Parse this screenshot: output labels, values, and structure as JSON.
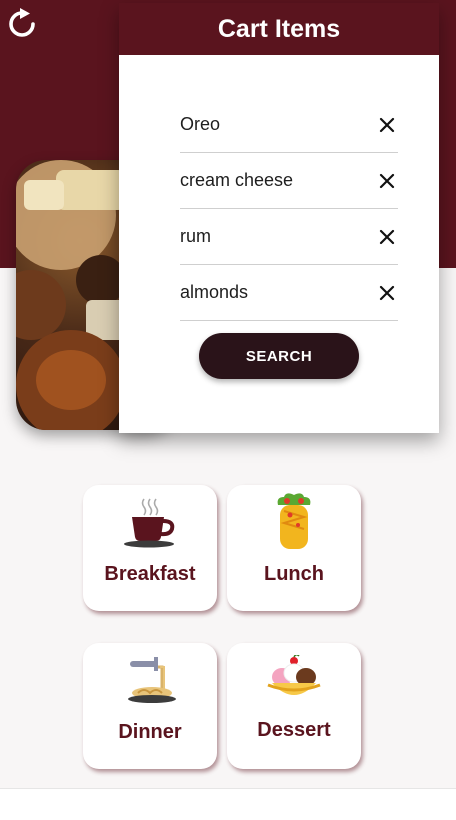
{
  "cart": {
    "title": "Cart Items",
    "items": [
      {
        "name": "Oreo"
      },
      {
        "name": "cream cheese"
      },
      {
        "name": "rum"
      },
      {
        "name": "almonds"
      }
    ],
    "search_label": "SEARCH"
  },
  "categories": [
    {
      "label": "Breakfast",
      "icon": "coffee-cup-icon"
    },
    {
      "label": "Lunch",
      "icon": "burrito-icon"
    },
    {
      "label": "Dinner",
      "icon": "spaghetti-icon"
    },
    {
      "label": "Dessert",
      "icon": "banana-split-icon"
    }
  ],
  "colors": {
    "primary": "#5a141e",
    "button": "#2a1319",
    "background": "#f8f6f6"
  }
}
